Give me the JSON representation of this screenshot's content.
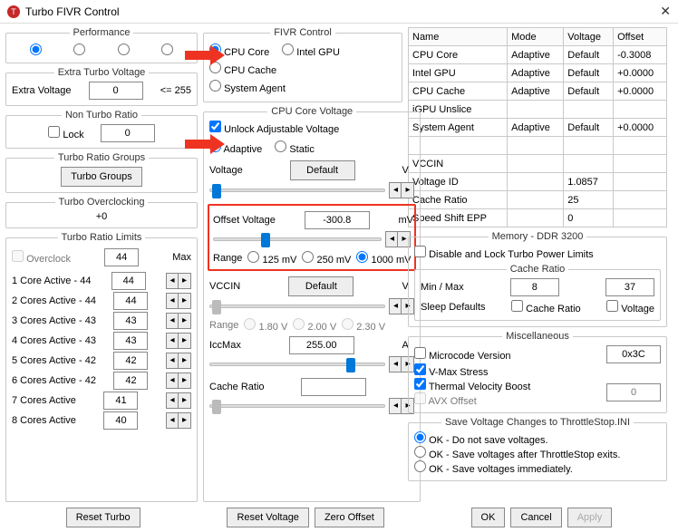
{
  "window": {
    "title": "Turbo FIVR Control",
    "close": "✕"
  },
  "performance": {
    "legend": "Performance"
  },
  "extraTurbo": {
    "legend": "Extra Turbo Voltage",
    "label": "Extra Voltage",
    "value": "0",
    "suffix": "<= 255"
  },
  "nonTurbo": {
    "legend": "Non Turbo Ratio",
    "lock": "Lock",
    "value": "0"
  },
  "trg": {
    "legend": "Turbo Ratio Groups",
    "btn": "Turbo Groups"
  },
  "toc": {
    "legend": "Turbo Overclocking",
    "value": "+0"
  },
  "trl": {
    "legend": "Turbo Ratio Limits",
    "overclock": "Overclock",
    "ocValue": "44",
    "max": "Max",
    "rows": [
      {
        "label": "1 Core  Active - 44",
        "val": "44"
      },
      {
        "label": "2 Cores Active - 44",
        "val": "44"
      },
      {
        "label": "3 Cores Active - 43",
        "val": "43"
      },
      {
        "label": "4 Cores Active - 43",
        "val": "43"
      },
      {
        "label": "5 Cores Active - 42",
        "val": "42"
      },
      {
        "label": "6 Cores Active - 42",
        "val": "42"
      },
      {
        "label": "7 Cores Active",
        "val": "41"
      },
      {
        "label": "8 Cores Active",
        "val": "40"
      }
    ]
  },
  "fivr": {
    "legend": "FIVR Control",
    "cpuCore": "CPU Core",
    "intelGpu": "Intel GPU",
    "cpuCache": "CPU Cache",
    "sysAgent": "System Agent"
  },
  "ccv": {
    "legend": "CPU Core Voltage",
    "unlock": "Unlock Adjustable Voltage",
    "adaptive": "Adaptive",
    "static": "Static",
    "voltageLabel": "Voltage",
    "voltageBtn": "Default",
    "vUnit": "V",
    "offsetLabel": "Offset Voltage",
    "offsetVal": "-300.8",
    "mV": "mV",
    "rangeLabel": "Range",
    "r125": "125 mV",
    "r250": "250 mV",
    "r1000": "1000 mV",
    "vccinLabel": "VCCIN",
    "vccinBtn": "Default",
    "vccinRange": "Range",
    "v180": "1.80 V",
    "v200": "2.00 V",
    "v230": "2.30 V",
    "iccLabel": "IccMax",
    "iccVal": "255.00",
    "aUnit": "A",
    "cacheRatio": "Cache Ratio"
  },
  "grid": {
    "head": {
      "name": "Name",
      "mode": "Mode",
      "volt": "Voltage",
      "off": "Offset"
    },
    "rows": [
      {
        "name": "CPU Core",
        "mode": "Adaptive",
        "volt": "Default",
        "off": "-0.3008"
      },
      {
        "name": "Intel GPU",
        "mode": "Adaptive",
        "volt": "Default",
        "off": "+0.0000"
      },
      {
        "name": "CPU Cache",
        "mode": "Adaptive",
        "volt": "Default",
        "off": "+0.0000"
      },
      {
        "name": "iGPU Unslice",
        "mode": "",
        "volt": "",
        "off": ""
      },
      {
        "name": "System Agent",
        "mode": "Adaptive",
        "volt": "Default",
        "off": "+0.0000"
      },
      {
        "name": "",
        "mode": "",
        "volt": "",
        "off": ""
      },
      {
        "name": "VCCIN",
        "mode": "",
        "volt": "",
        "off": ""
      },
      {
        "name": "Voltage ID",
        "mode": "",
        "volt": "1.0857",
        "off": ""
      },
      {
        "name": "Cache Ratio",
        "mode": "",
        "volt": "25",
        "off": ""
      },
      {
        "name": "Speed Shift EPP",
        "mode": "",
        "volt": "0",
        "off": ""
      }
    ]
  },
  "mem": {
    "legend": "Memory - DDR 3200",
    "disable": "Disable and Lock Turbo Power Limits",
    "crLegend": "Cache Ratio",
    "minmax": "Min / Max",
    "min": "8",
    "max": "37",
    "sleep": "Sleep Defaults",
    "cbCR": "Cache Ratio",
    "cbV": "Voltage"
  },
  "misc": {
    "legend": "Miscellaneous",
    "micro": "Microcode Version",
    "microVal": "0x3C",
    "vmax": "V-Max Stress",
    "tvb": "Thermal Velocity Boost",
    "avx": "AVX Offset",
    "avxVal": "0"
  },
  "save": {
    "legend": "Save Voltage Changes to ThrottleStop.INI",
    "o1": "OK - Do not save voltages.",
    "o2": "OK - Save voltages after ThrottleStop exits.",
    "o3": "OK - Save voltages immediately."
  },
  "footer": {
    "resetTurbo": "Reset Turbo",
    "resetVolt": "Reset Voltage",
    "zeroOffset": "Zero Offset",
    "ok": "OK",
    "cancel": "Cancel",
    "apply": "Apply"
  }
}
